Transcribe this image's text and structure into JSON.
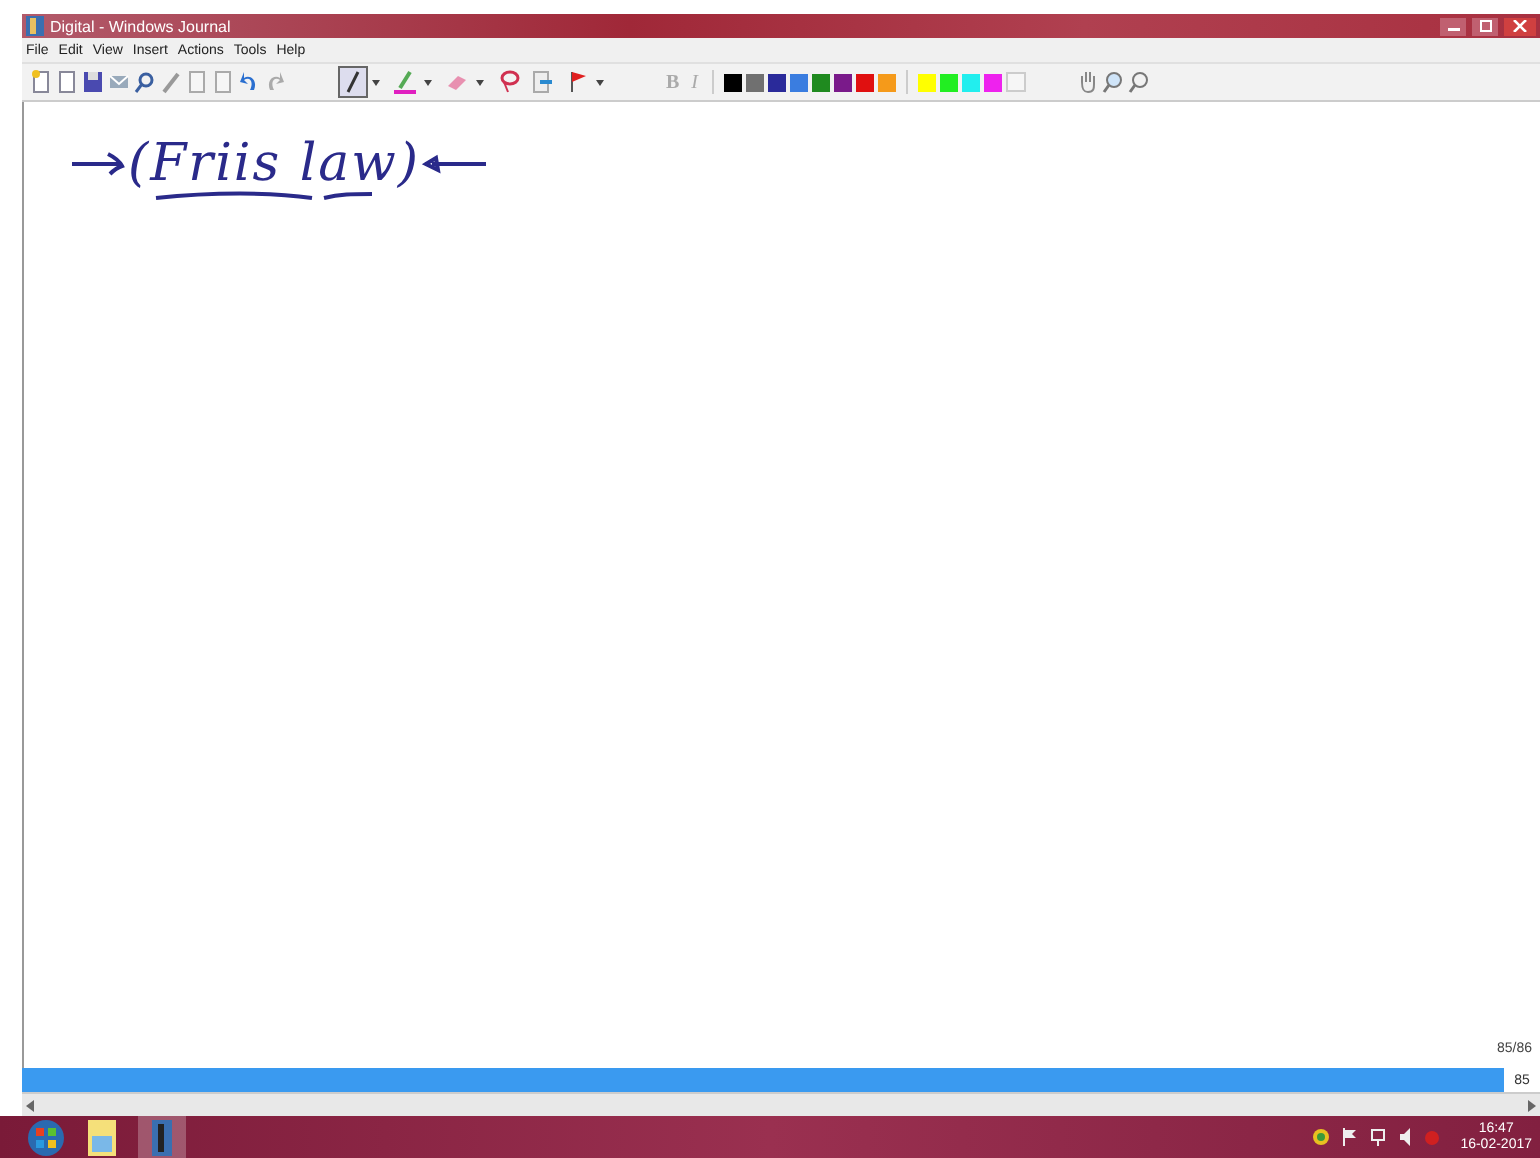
{
  "window": {
    "title": "Digital - Windows Journal"
  },
  "menu": [
    "File",
    "Edit",
    "View",
    "Insert",
    "Actions",
    "Tools",
    "Help"
  ],
  "drawing_tools": [
    {
      "kind": "pen",
      "selected": true
    },
    {
      "kind": "highlighter",
      "selected": false
    },
    {
      "kind": "eraser",
      "selected": false
    },
    {
      "kind": "lasso",
      "selected": false
    },
    {
      "kind": "insert-space",
      "selected": false
    },
    {
      "kind": "flag",
      "selected": false
    }
  ],
  "format": [
    "B",
    "I"
  ],
  "palette": [
    {
      "color": "#000000"
    },
    {
      "color": "#707070"
    },
    {
      "color": "#2a2a9a"
    },
    {
      "color": "#3a7de0"
    },
    {
      "color": "#1f8a1f"
    },
    {
      "color": "#7a1a8a"
    },
    {
      "color": "#e01010"
    },
    {
      "color": "#f59a1a"
    },
    {
      "color": "#ffff00"
    },
    {
      "color": "#22ee22"
    },
    {
      "color": "#22eeee"
    },
    {
      "color": "#ee22ee"
    }
  ],
  "ink": {
    "text": "(Friis law)"
  },
  "page_counter": "85/86",
  "page_bar": {
    "label": "85"
  },
  "clock": {
    "time": "16:47",
    "date": "16-02-2017"
  }
}
